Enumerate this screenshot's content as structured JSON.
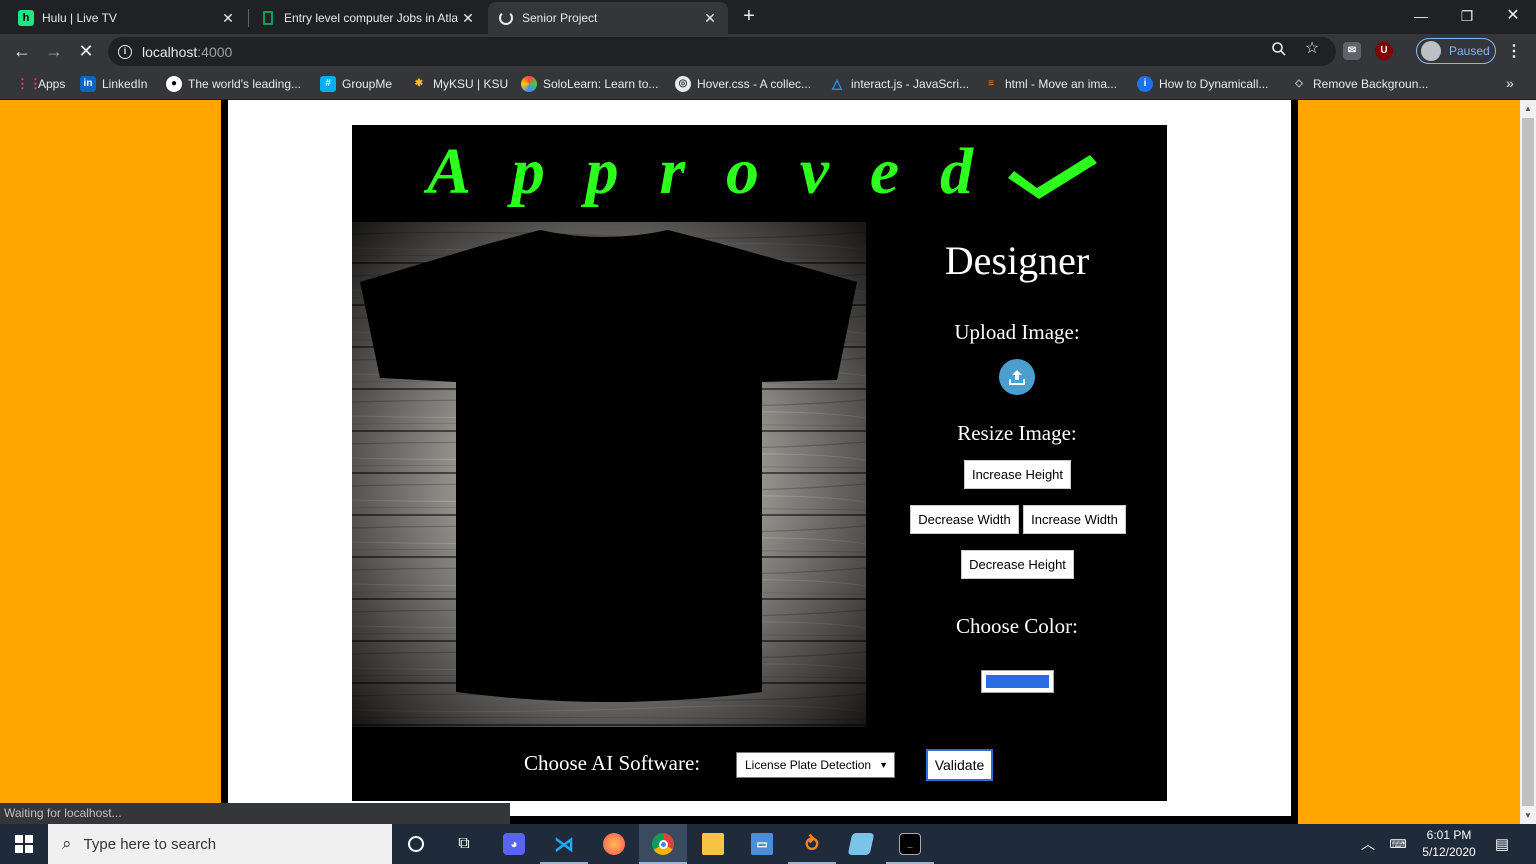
{
  "browser": {
    "tabs": [
      {
        "title": "Hulu | Live TV",
        "favicon": "hulu-icon"
      },
      {
        "title": "Entry level computer Jobs in Atla",
        "favicon": "sheets-icon"
      },
      {
        "title": "Senior Project",
        "favicon": "loading-spinner-icon"
      }
    ],
    "url_host": "localhost",
    "url_port": ":4000",
    "profile_label": "Paused",
    "bookmarks": [
      {
        "label": "Apps",
        "icon": "apps-grid-icon"
      },
      {
        "label": "LinkedIn",
        "icon": "linkedin-icon"
      },
      {
        "label": "The world's leading...",
        "icon": "github-icon"
      },
      {
        "label": "GroupMe",
        "icon": "groupme-icon"
      },
      {
        "label": "MyKSU | KSU",
        "icon": "ksu-icon"
      },
      {
        "label": "SoloLearn: Learn to...",
        "icon": "sololearn-icon"
      },
      {
        "label": "Hover.css - A collec...",
        "icon": "globe-icon"
      },
      {
        "label": "interact.js - JavaScri...",
        "icon": "interactjs-icon"
      },
      {
        "label": "html - Move an ima...",
        "icon": "stackoverflow-icon"
      },
      {
        "label": "How to Dynamicall...",
        "icon": "site-icon"
      },
      {
        "label": "Remove Backgroun...",
        "icon": "removebg-icon"
      }
    ],
    "status_text": "Waiting for localhost..."
  },
  "page": {
    "logo_text": "Approved",
    "designer": {
      "title": "Designer",
      "upload_label": "Upload Image:",
      "resize_label": "Resize Image:",
      "increase_height": "Increase Height",
      "decrease_width": "Decrease Width",
      "increase_width": "Increase Width",
      "decrease_height": "Decrease Height",
      "color_label": "Choose Color:",
      "color_value": "#2a6de0"
    },
    "ai_label": "Choose AI Software:",
    "ai_selected": "License Plate Detection",
    "validate_label": "Validate",
    "colors": {
      "background": "#ffa500",
      "logo_green": "#2dff1e",
      "panel": "#000000"
    }
  },
  "taskbar": {
    "search_placeholder": "Type here to search",
    "time": "6:01 PM",
    "date": "5/12/2020"
  }
}
